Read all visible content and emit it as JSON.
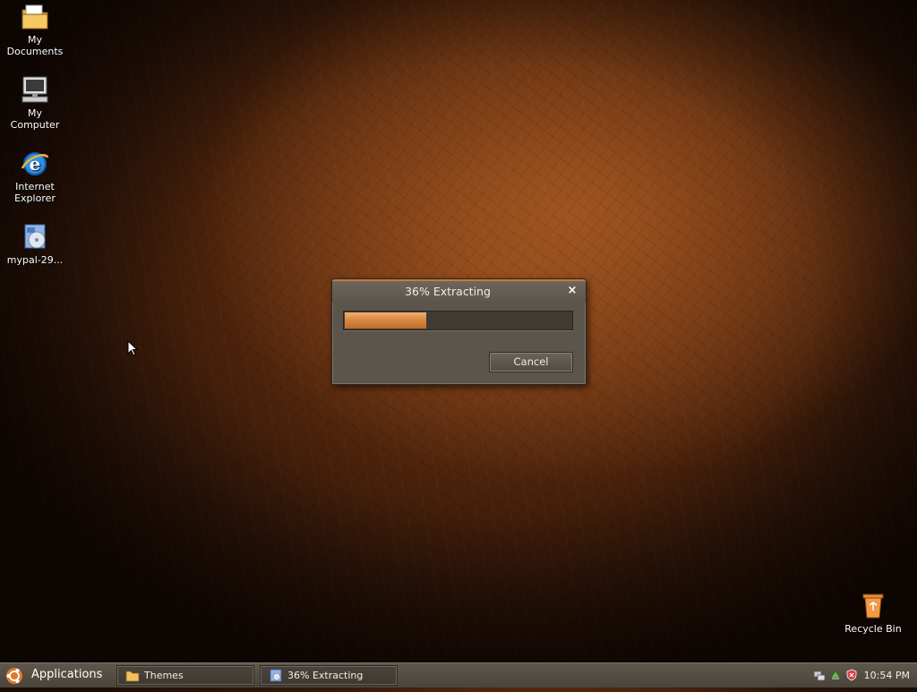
{
  "desktop": {
    "icons": [
      {
        "label": "My Documents",
        "icon": "folder-documents-icon"
      },
      {
        "label": "My Computer",
        "icon": "computer-icon"
      },
      {
        "label": "Internet Explorer",
        "icon": "internet-explorer-icon"
      },
      {
        "label": "mypal-29...",
        "icon": "installer-icon"
      },
      {
        "label": "Recycle Bin",
        "icon": "recycle-bin-icon"
      }
    ]
  },
  "dialog": {
    "title": "36% Extracting",
    "close_label": "×",
    "progress": 36,
    "cancel_label": "Cancel"
  },
  "taskbar": {
    "start_label": "Applications",
    "tasks": [
      {
        "label": "Themes",
        "icon": "folder-icon"
      },
      {
        "label": "36% Extracting",
        "icon": "extract-icon"
      }
    ],
    "tray_icons": [
      "network-icon",
      "safely-remove-icon",
      "security-shield-icon"
    ],
    "clock": "10:54 PM"
  },
  "colors": {
    "accent": "#d98a43",
    "taskbar": "#5e574d",
    "dialog_bg": "#5c554c"
  }
}
